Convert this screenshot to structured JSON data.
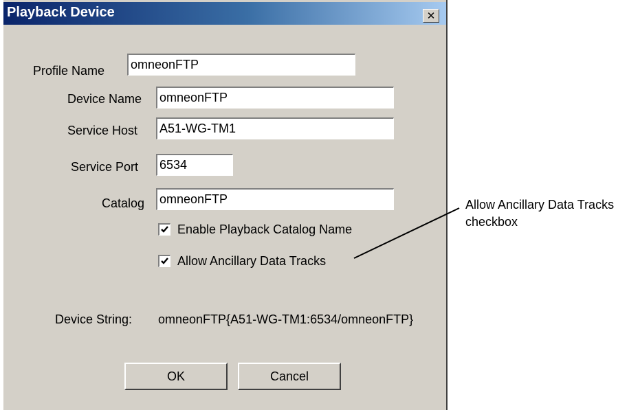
{
  "dialog": {
    "title": "Playback Device",
    "close_label": "✕"
  },
  "form": {
    "profile_name": {
      "label": "Profile Name",
      "value": "omneonFTP"
    },
    "device_name": {
      "label": "Device Name",
      "value": "omneonFTP"
    },
    "service_host": {
      "label": "Service Host",
      "value": "A51-WG-TM1"
    },
    "service_port": {
      "label": "Service Port",
      "value": "6534"
    },
    "catalog": {
      "label": "Catalog",
      "value": "omneonFTP"
    },
    "enable_playback_catalog_name": {
      "label": "Enable Playback Catalog Name",
      "checked": true
    },
    "allow_ancillary_data_tracks": {
      "label": "Allow Ancillary Data Tracks",
      "checked": true
    },
    "device_string": {
      "label": "Device String:",
      "value": "omneonFTP{A51-WG-TM1:6534/omneonFTP}"
    }
  },
  "buttons": {
    "ok": "OK",
    "cancel": "Cancel"
  },
  "annotation": {
    "line1": "Allow Ancillary Data Tracks",
    "line2": "checkbox"
  }
}
